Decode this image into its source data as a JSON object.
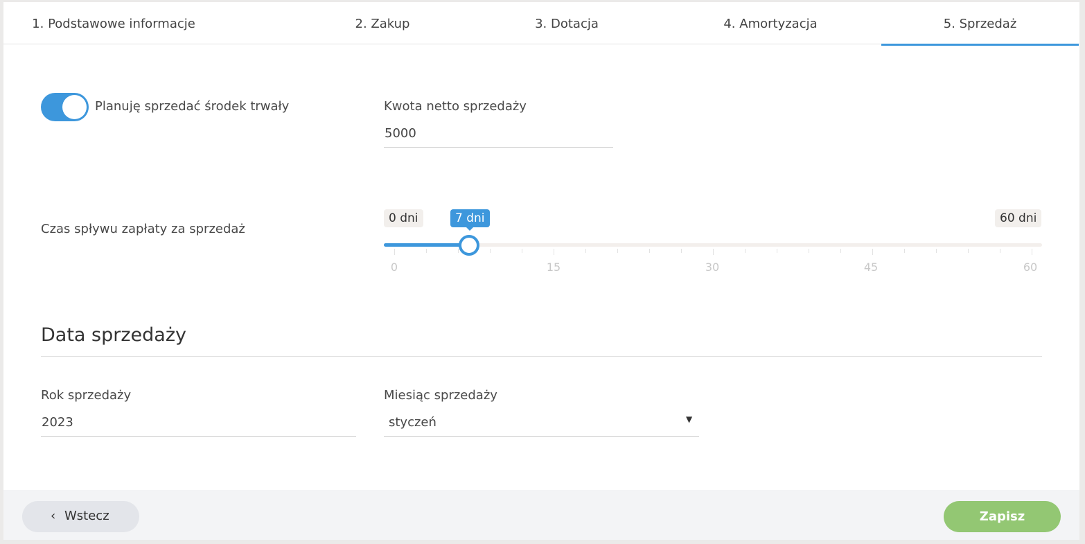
{
  "tabs": [
    {
      "label": "1. Podstawowe informacje"
    },
    {
      "label": "2. Zakup"
    },
    {
      "label": "3. Dotacja"
    },
    {
      "label": "4. Amortyzacja"
    },
    {
      "label": "5. Sprzedaż"
    }
  ],
  "active_tab": "5. Sprzedaż",
  "sale_toggle": {
    "label": "Planuję sprzedać środek trwały",
    "on": true
  },
  "net_amount": {
    "label": "Kwota netto sprzedaży",
    "value": "5000"
  },
  "payment_slider": {
    "label": "Czas spływu zapłaty za sprzedaż",
    "min_label": "0 dni",
    "max_label": "60 dni",
    "value_label": "7 dni",
    "value": 7,
    "min": 0,
    "max": 60,
    "tick_labels": [
      "0",
      "15",
      "30",
      "45",
      "60"
    ]
  },
  "sale_date": {
    "title": "Data sprzedaży",
    "year_label": "Rok sprzedaży",
    "year_value": "2023",
    "month_label": "Miesiąc sprzedaży",
    "month_value": "styczeń"
  },
  "footer": {
    "back_label": "Wstecz",
    "save_label": "Zapisz"
  },
  "icons": {
    "back": "chevron-left-icon",
    "select": "caret-down-icon"
  },
  "colors": {
    "accent": "#3d97dc",
    "save": "#93c773"
  }
}
